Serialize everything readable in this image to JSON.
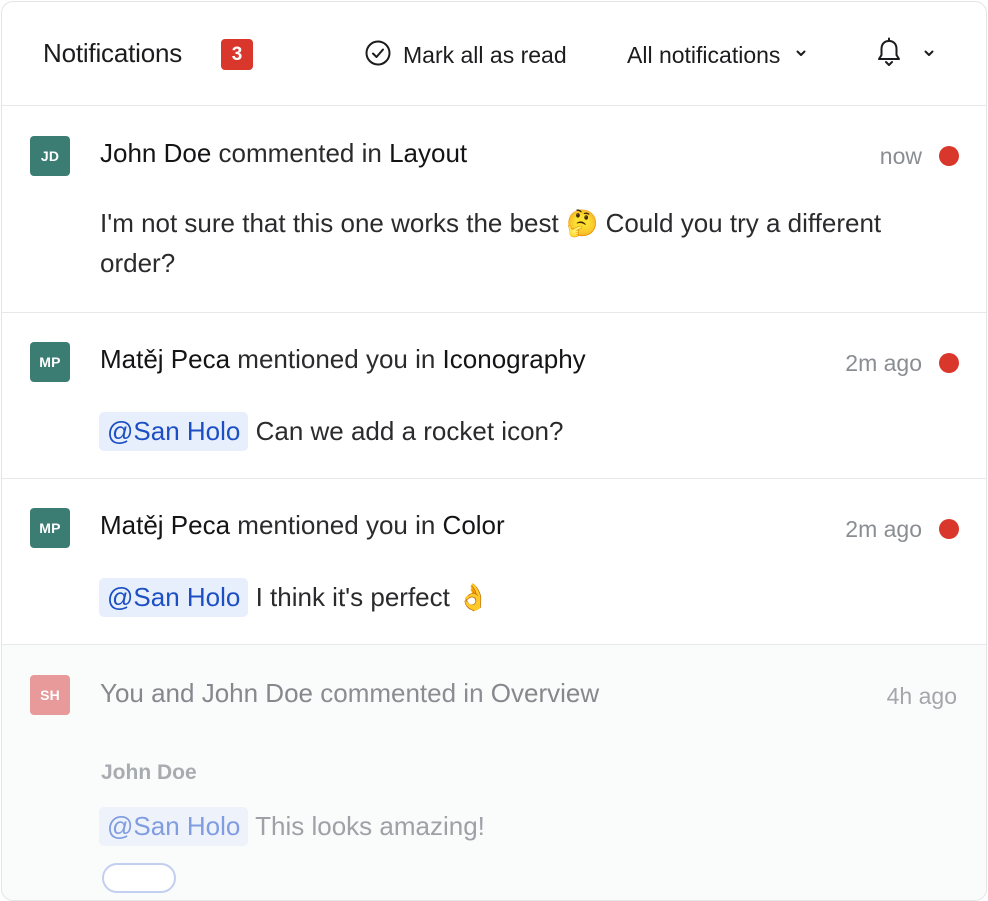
{
  "header": {
    "title": "Notifications",
    "count": "3",
    "mark_all_label": "Mark all as read",
    "filter_label": "All notifications",
    "icons": {
      "mark_all": "check-circle-icon",
      "filter_chevron": "chevron-down-icon",
      "bell": "bell-icon",
      "bell_chevron": "chevron-down-icon"
    }
  },
  "colors": {
    "badge": "#d9372b",
    "unread_dot": "#d9372b",
    "avatar_teal": "#3b7d72",
    "avatar_pink": "#e89a9a",
    "mention_text": "#1d4fc4",
    "mention_bg": "#e8effc"
  },
  "notifications": [
    {
      "avatar": "JD",
      "actor": "John Doe",
      "verb": " commented in ",
      "target": "Layout",
      "time": "now",
      "unread": true,
      "body": "I'm not sure that this one works the best 🤔 Could you try a different order?"
    },
    {
      "avatar": "MP",
      "actor": "Matěj Peca",
      "verb": " mentioned you in ",
      "target": "Iconography",
      "time": "2m ago",
      "unread": true,
      "mention": "@San Holo",
      "body": "Can we add a rocket icon?"
    },
    {
      "avatar": "MP",
      "actor": "Matěj Peca",
      "verb": " mentioned you in ",
      "target": "Color",
      "time": "2m ago",
      "unread": true,
      "mention": "@San Holo",
      "body": "I think it's perfect 👌"
    },
    {
      "avatar": "SH",
      "actor": "You and John Doe",
      "verb": " commented in ",
      "target": "Overview",
      "time": "4h ago",
      "unread": false,
      "sub_author": "John Doe",
      "mention": "@San Holo",
      "body": "This looks amazing!"
    }
  ]
}
